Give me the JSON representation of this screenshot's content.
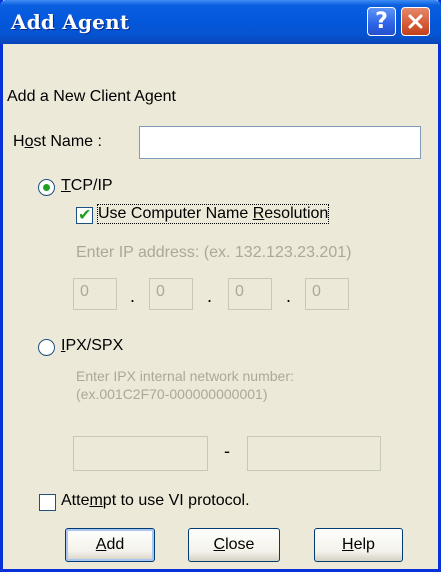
{
  "window": {
    "title": "Add Agent"
  },
  "titlebar": {
    "help_label": "?",
    "close_label": "✕"
  },
  "heading": "Add a New Client Agent",
  "host_name": {
    "label_pre": "H",
    "label_acc": "o",
    "label_post": "st Name :",
    "value": ""
  },
  "tcpip": {
    "label_acc": "T",
    "label_rest": "CP/IP",
    "selected": true,
    "resolution": {
      "label_pre": "Use Computer Name ",
      "label_acc": "R",
      "label_post": "esolution",
      "checked": true
    },
    "ip_hint": "Enter IP address: (ex. 132.123.23.201)",
    "ip_octets": [
      "0",
      "0",
      "0",
      "0"
    ],
    "separator": "."
  },
  "ipxspx": {
    "label_acc": "I",
    "label_rest": "PX/SPX",
    "selected": false,
    "hint_line1": "Enter IPX internal network number:",
    "hint_line2": "(ex.001C2F70-000000000001)",
    "separator": "-"
  },
  "vi_protocol": {
    "label_pre": "Atte",
    "label_acc": "m",
    "label_post": "pt to use VI protocol.",
    "checked": false
  },
  "buttons": {
    "add": {
      "acc": "A",
      "rest": "dd"
    },
    "close": {
      "acc": "C",
      "rest": "lose"
    },
    "help": {
      "acc": "H",
      "rest": "elp"
    }
  },
  "colors": {
    "title_bar": "#0458dc",
    "accent_check": "#21a121",
    "face": "#ece9d8"
  },
  "icons": {
    "help": "help-icon",
    "close": "close-icon"
  }
}
